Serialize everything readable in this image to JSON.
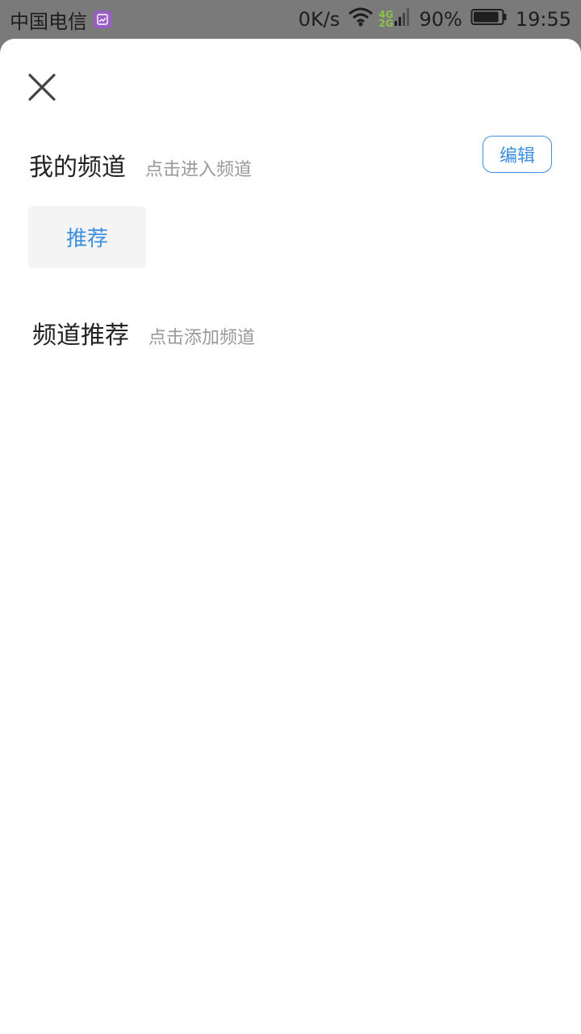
{
  "status_bar": {
    "carrier": "中国电信",
    "speed": "0K/s",
    "net_top": "4G",
    "net_bottom": "2G",
    "battery": "90%",
    "time": "19:55",
    "battery_level": 0.9,
    "icons": [
      "image-notification-icon",
      "wifi-icon",
      "signal-icon",
      "battery-icon"
    ]
  },
  "sheet": {
    "close_icon": "close-icon",
    "my_channels": {
      "title": "我的频道",
      "hint": "点击进入频道",
      "edit_label": "编辑",
      "channels": [
        {
          "label": "推荐"
        }
      ]
    },
    "recommended_channels": {
      "title": "频道推荐",
      "hint": "点击添加频道"
    }
  },
  "colors": {
    "accent": "#3d8fe0",
    "title_text": "#222222",
    "hint_text": "#999999",
    "chip_bg": "#f4f4f4",
    "status_bar_bg": "#7a7a7a"
  }
}
